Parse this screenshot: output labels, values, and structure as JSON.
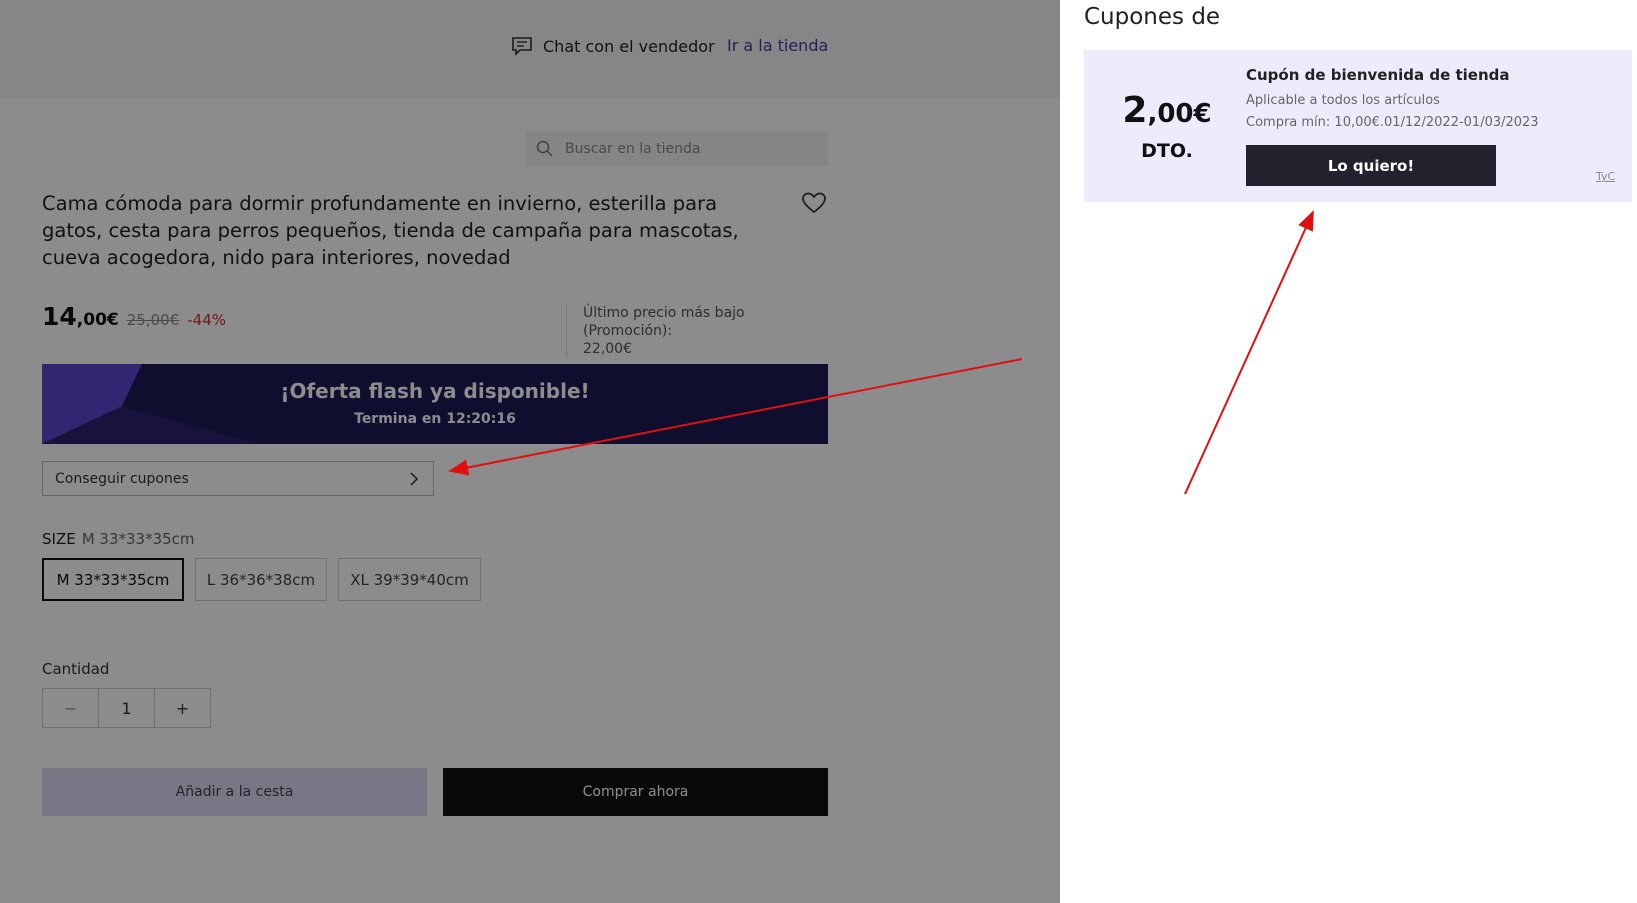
{
  "header": {
    "chat_label": "Chat con el vendedor",
    "store_link": "Ir a la tienda",
    "icons": {
      "chat": "chat-bubble-icon"
    }
  },
  "search": {
    "placeholder": "Buscar en la tienda",
    "icon": "search-icon"
  },
  "product": {
    "title": "Cama cómoda para dormir profundamente en invierno, esterilla para gatos, cesta para perros pequeños, tienda de campaña para mascotas, cueva acogedora, nido para interiores, novedad",
    "price_int": "14",
    "price_dec": ",00€",
    "price_old": "25,00€",
    "discount": "-44%",
    "lowest_label": "Último precio más bajo (Promoción):",
    "lowest_value": "22,00€"
  },
  "flash": {
    "title": "¡Oferta flash ya disponible!",
    "subtitle": "Termina en 12:20:16"
  },
  "coupons_button": "Conseguir cupones",
  "size": {
    "label": "SIZE",
    "selected": "M 33*33*35cm",
    "options": [
      "M 33*33*35cm",
      "L 36*36*38cm",
      "XL 39*39*40cm"
    ]
  },
  "quantity": {
    "label": "Cantidad",
    "minus": "−",
    "value": "1",
    "plus": "+"
  },
  "actions": {
    "add_to_cart": "Añadir a la cesta",
    "buy_now": "Comprar ahora"
  },
  "drawer": {
    "title": "Cupones de",
    "coupon": {
      "amount_int": "2",
      "amount_dec": ",00€",
      "dto": "DTO.",
      "name": "Cupón de bienvenida de tienda",
      "applies": "Aplicable a todos los artículos",
      "min_purchase": "Compra mín: 10,00€.01/12/2022-01/03/2023",
      "button": "Lo quiero!",
      "terms": "TyC"
    }
  },
  "colors": {
    "accent": "#3b3fa8",
    "flash_bg": "#2a246e",
    "coupon_bg": "#eeebfd",
    "annotation": "#e01010"
  }
}
